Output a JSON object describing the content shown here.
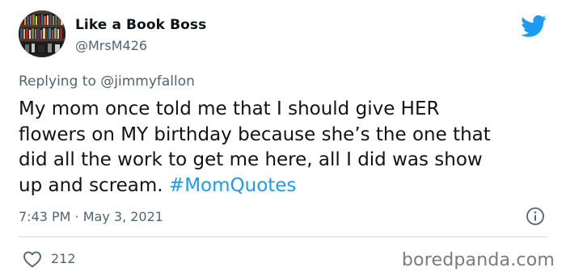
{
  "author": {
    "display_name": "Like a Book Boss",
    "handle": "@MrsM426",
    "avatar_icon": "bookshelf-avatar"
  },
  "reply": {
    "prefix": "Replying to ",
    "mention": "@jimmyfallon"
  },
  "tweet": {
    "text": "My mom once told me that I should give HER\nflowers on MY birthday because she’s the one that\ndid all the work to get me here, all I did was show\nup and scream. ",
    "hashtag": "#MomQuotes",
    "timestamp": "7:43 PM · May 3, 2021"
  },
  "actions": {
    "likes": "212",
    "like_icon": "heart-icon",
    "info_icon": "info-icon"
  },
  "brand": {
    "twitter_icon": "twitter-bird-icon",
    "watermark": "boredpanda.com"
  },
  "colors": {
    "accent": "#1d9bf0",
    "secondary_text": "#536471",
    "primary_text": "#0f1419",
    "divider": "#cfd9de"
  }
}
